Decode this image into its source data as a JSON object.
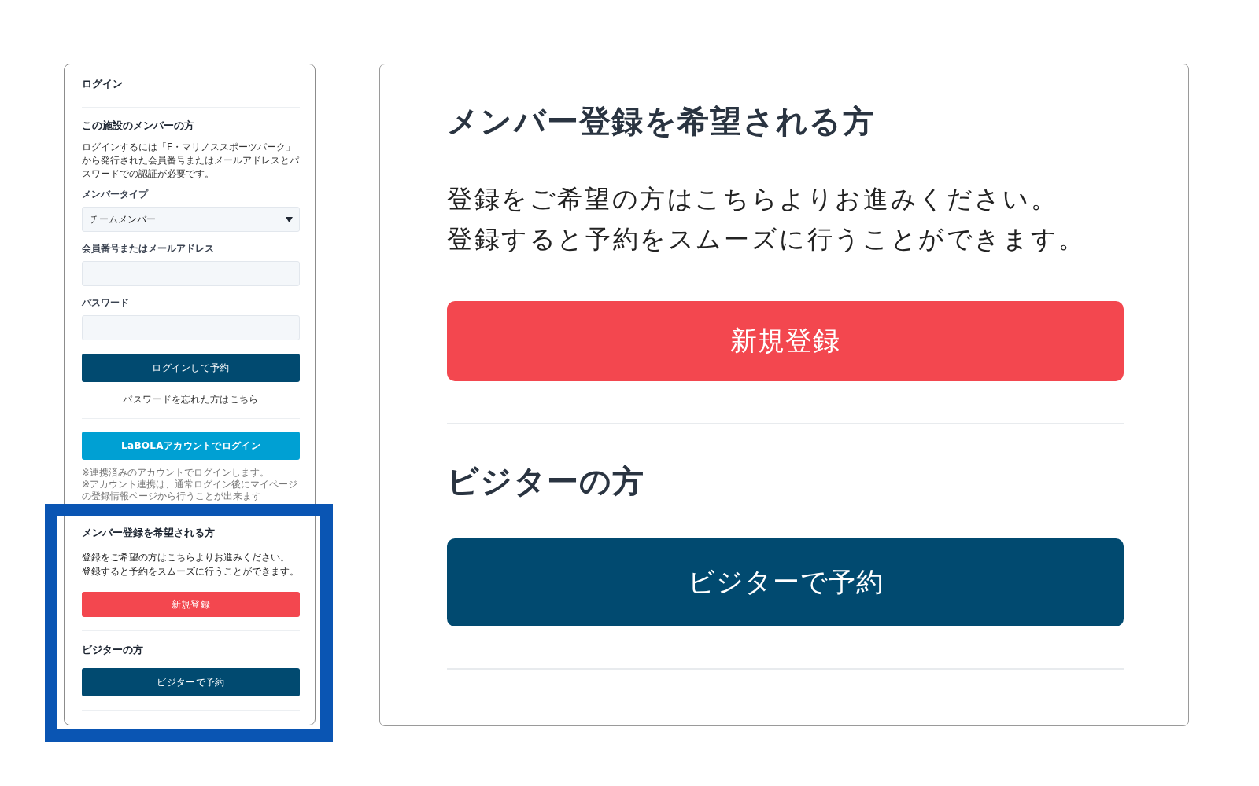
{
  "login_panel": {
    "title": "ログイン",
    "member_login": {
      "heading": "この施設のメンバーの方",
      "description": "ログインするには「F・マリノススポーツパーク」から発行された会員番号またはメールアドレスとパスワードでの認証が必要です。",
      "fields": [
        {
          "kind": "select",
          "label": "メンバータイプ",
          "value": "チームメンバー"
        },
        {
          "kind": "input",
          "label": "会員番号またはメールアドレス"
        },
        {
          "kind": "input",
          "label": "パスワード"
        }
      ],
      "login_button": "ログインして予約",
      "forgot_password_link": "パスワードを忘れた方はこちら"
    },
    "labola_login_button": "LaBOLAアカウントでログイン",
    "notes": [
      "※連携済みのアカウントでログインします。",
      "※アカウント連携は、通常ログイン後にマイページの登録情報ページから行うことが出来ます"
    ],
    "member_registration": {
      "heading": "メンバー登録を希望される方",
      "lines": [
        "登録をご希望の方はこちらよりお進みください。",
        "登録すると予約をスムーズに行うことができます。"
      ],
      "button": "新規登録"
    },
    "visitor": {
      "heading": "ビジターの方",
      "button": "ビジターで予約"
    }
  },
  "enlarged_view": {
    "member_registration": {
      "heading": "メンバー登録を希望される方",
      "lines": [
        "登録をご希望の方はこちらよりお進みください。",
        "登録すると予約をスムーズに行うことができます。"
      ],
      "button": "新規登録"
    },
    "visitor": {
      "heading": "ビジターの方",
      "button": "ビジターで予約"
    }
  }
}
